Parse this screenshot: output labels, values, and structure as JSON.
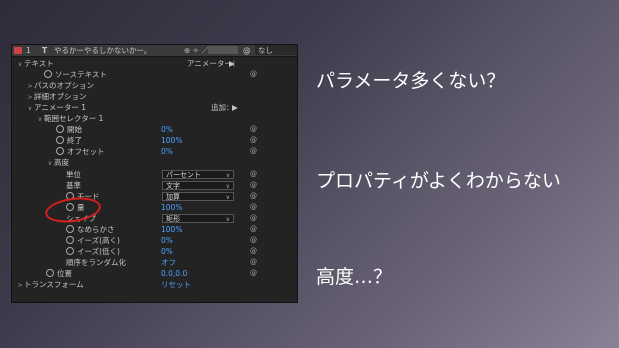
{
  "layer": {
    "number": "1",
    "type": "T",
    "name": "やるかーやるしかないかー。",
    "parent": "なし"
  },
  "props": [
    {
      "label": "テキスト",
      "indent": 0,
      "twirl": "∨",
      "val": "",
      "right": "アニメーター：",
      "right_icon": "▶"
    },
    {
      "label": "ソーステキスト",
      "indent": 2,
      "twirl": "",
      "stopwatch": true,
      "val": ""
    },
    {
      "label": "パスのオプション",
      "indent": 1,
      "twirl": ">",
      "val": ""
    },
    {
      "label": "詳細オプション",
      "indent": 1,
      "twirl": ">",
      "val": ""
    },
    {
      "label": "アニメーター 1",
      "indent": 1,
      "twirl": "∨",
      "val": "",
      "right": "追加：",
      "right_icon": "▶"
    },
    {
      "label": "範囲セレクター 1",
      "indent": 2,
      "twirl": "∨",
      "val": ""
    },
    {
      "label": "開始",
      "indent": 4,
      "stopwatch": true,
      "val": "0%"
    },
    {
      "label": "終了",
      "indent": 4,
      "stopwatch": true,
      "val": "100%"
    },
    {
      "label": "オフセット",
      "indent": 4,
      "stopwatch": true,
      "val": "0%"
    },
    {
      "label": "高度",
      "indent": 3,
      "twirl": "∨",
      "val": ""
    },
    {
      "label": "単位",
      "indent": 5,
      "dropdown": "パーセント"
    },
    {
      "label": "基準",
      "indent": 5,
      "dropdown": "文字"
    },
    {
      "label": "モード",
      "indent": 5,
      "stopwatch": true,
      "dropdown": "加算"
    },
    {
      "label": "量",
      "indent": 5,
      "stopwatch": true,
      "val": "100%"
    },
    {
      "label": "シェイプ",
      "indent": 5,
      "dropdown": "矩形"
    },
    {
      "label": "なめらかさ",
      "indent": 5,
      "stopwatch": true,
      "val": "100%"
    },
    {
      "label": "イーズ(高く)",
      "indent": 5,
      "stopwatch": true,
      "val": "0%"
    },
    {
      "label": "イーズ(低く)",
      "indent": 5,
      "stopwatch": true,
      "val": "0%"
    },
    {
      "label": "順序をランダム化",
      "indent": 5,
      "val": "オフ"
    },
    {
      "label": "位置",
      "indent": 3,
      "stopwatch": true,
      "val": "0.0,0.0"
    },
    {
      "label": "トランスフォーム",
      "indent": 0,
      "twirl": ">",
      "val": "リセット"
    }
  ],
  "captions": {
    "line1": "パラメータ多くない？",
    "line2": "プロパティがよくわからない",
    "line3": "高度…？"
  },
  "colors": {
    "accent_blue": "#4da3ff",
    "highlight_red": "#d62020"
  }
}
